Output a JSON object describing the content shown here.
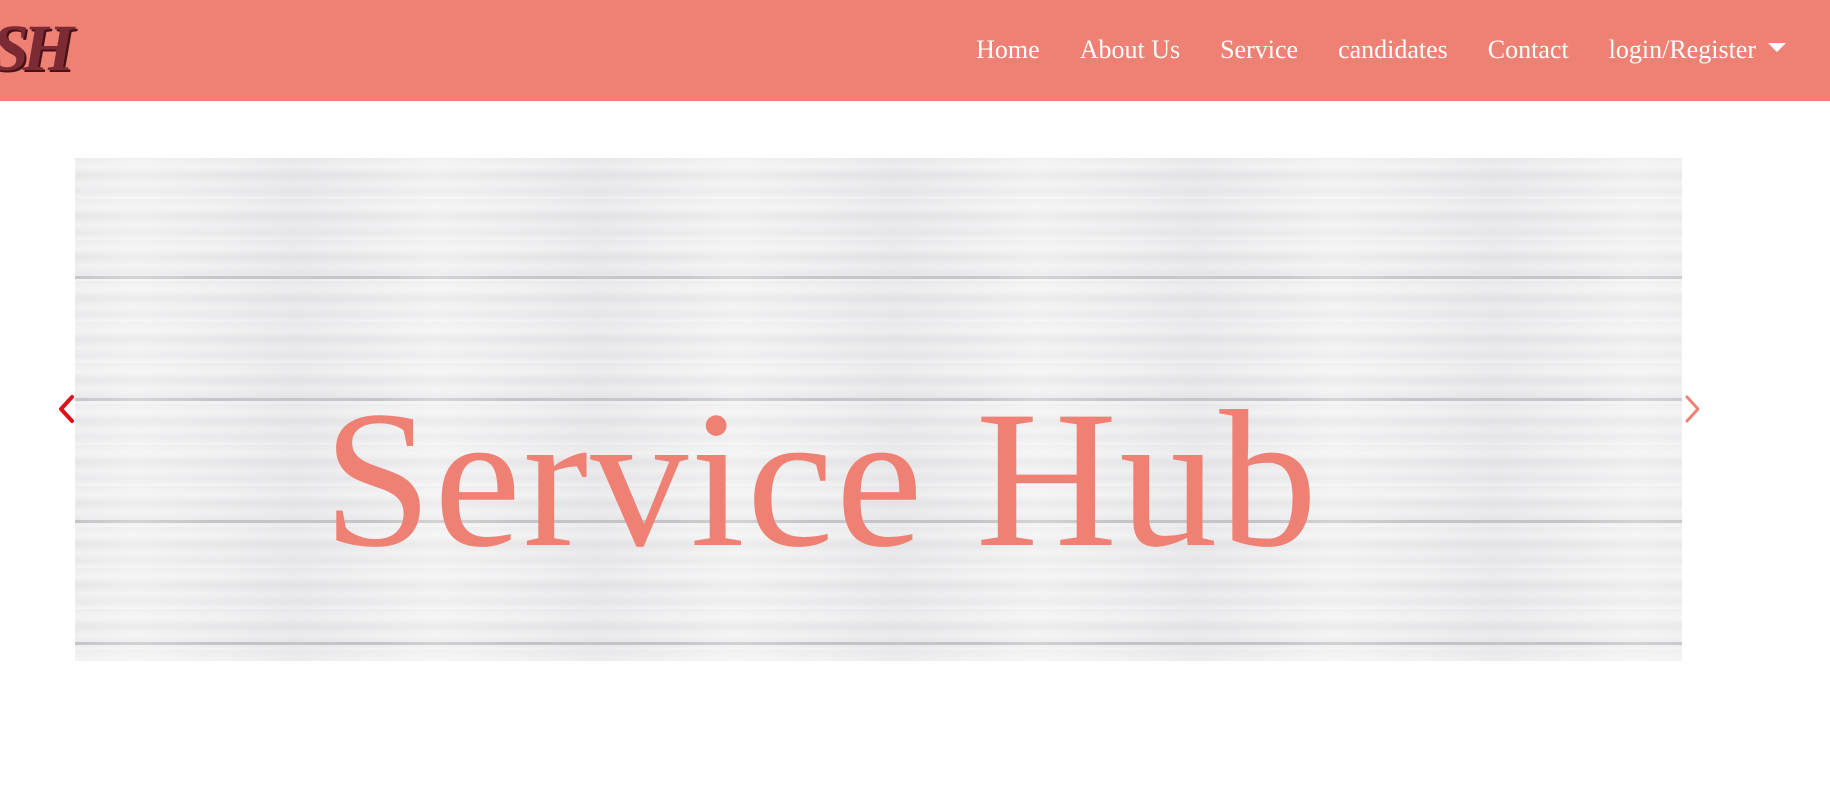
{
  "navbar": {
    "logo_text": "SH",
    "links": [
      "Home",
      "About Us",
      "Service",
      "candidates",
      "Contact"
    ],
    "dropdown_label": "login/Register"
  },
  "carousel": {
    "slide_title": "Service Hub",
    "prev_icon": "chevron-left-icon",
    "next_icon": "chevron-right-icon"
  },
  "colors": {
    "brand": "#ef8174",
    "nav_text": "#ffffff",
    "prev_arrow": "#e0101a",
    "next_arrow": "#ef8174"
  }
}
